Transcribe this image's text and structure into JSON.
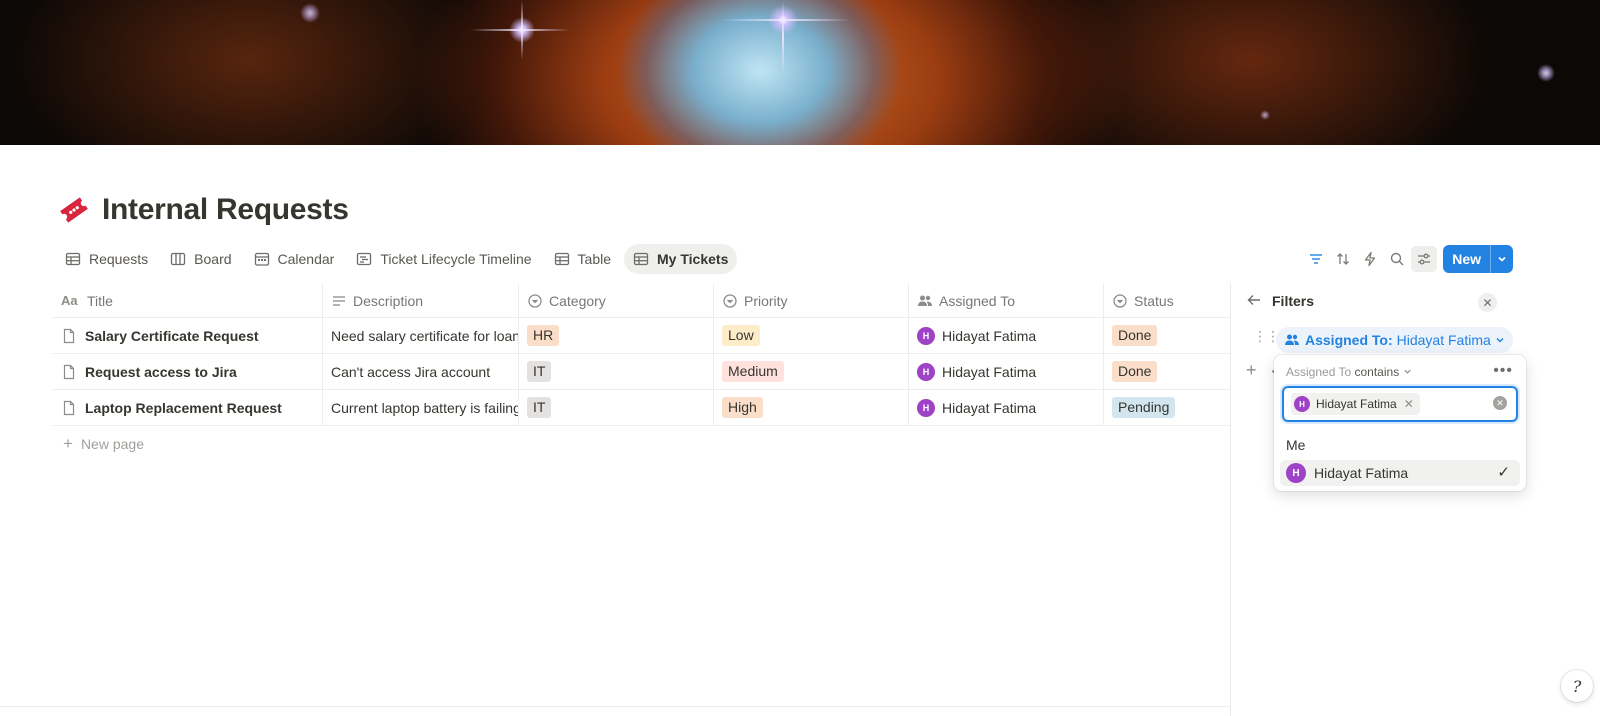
{
  "page": {
    "title": "Internal Requests",
    "title_icon": "ticket-icon"
  },
  "tabs": [
    {
      "label": "Requests",
      "icon": "table-icon"
    },
    {
      "label": "Board",
      "icon": "board-icon"
    },
    {
      "label": "Calendar",
      "icon": "calendar-icon"
    },
    {
      "label": "Ticket Lifecycle Timeline",
      "icon": "timeline-icon"
    },
    {
      "label": "Table",
      "icon": "table-icon"
    },
    {
      "label": "My Tickets",
      "icon": "table-icon",
      "active": true
    }
  ],
  "toolbar": {
    "new_label": "New",
    "icons": [
      "filter-icon",
      "sort-icon",
      "automation-icon",
      "search-icon",
      "settings-icon",
      "chevron-down-icon"
    ]
  },
  "table": {
    "columns": [
      {
        "label": "Title",
        "icon": "text-icon"
      },
      {
        "label": "Description",
        "icon": "lines-icon"
      },
      {
        "label": "Category",
        "icon": "select-icon"
      },
      {
        "label": "Priority",
        "icon": "select-icon"
      },
      {
        "label": "Assigned To",
        "icon": "people-icon"
      },
      {
        "label": "Status",
        "icon": "select-icon"
      }
    ],
    "rows": [
      {
        "title": "Salary Certificate Request",
        "description": "Need salary certificate for loan a",
        "category": "HR",
        "priority": "Low",
        "assigned": "Hidayat Fatima",
        "avatar": "H",
        "status": "Done"
      },
      {
        "title": "Request access to Jira",
        "description": "Can't access Jira account",
        "category": "IT",
        "priority": "Medium",
        "assigned": "Hidayat Fatima",
        "avatar": "H",
        "status": "Done"
      },
      {
        "title": "Laptop Replacement Request",
        "description": "Current laptop battery is failing",
        "category": "IT",
        "priority": "High",
        "assigned": "Hidayat Fatima",
        "avatar": "H",
        "status": "Pending"
      }
    ],
    "new_page_label": "New page"
  },
  "colors": {
    "accent": "#2383e2",
    "avatar": "#9e42c6",
    "pill_hr": "#fadec9",
    "pill_it": "#e3e2e0",
    "pill_low": "#fdecc8",
    "pill_medium": "#ffe2dd",
    "pill_high": "#fadec9",
    "pill_done": "#fadec9",
    "pill_pending": "#d3e5ef"
  },
  "filters": {
    "title": "Filters",
    "chip_property": "Assigned To:",
    "chip_value": "Hidayat Fatima",
    "condition_property": "Assigned To",
    "condition_operator": "contains",
    "selected_token": "Hidayat Fatima",
    "section_label": "Me",
    "option_label": "Hidayat Fatima",
    "option_avatar": "H",
    "check": "✓"
  },
  "help": {
    "label": "?"
  }
}
